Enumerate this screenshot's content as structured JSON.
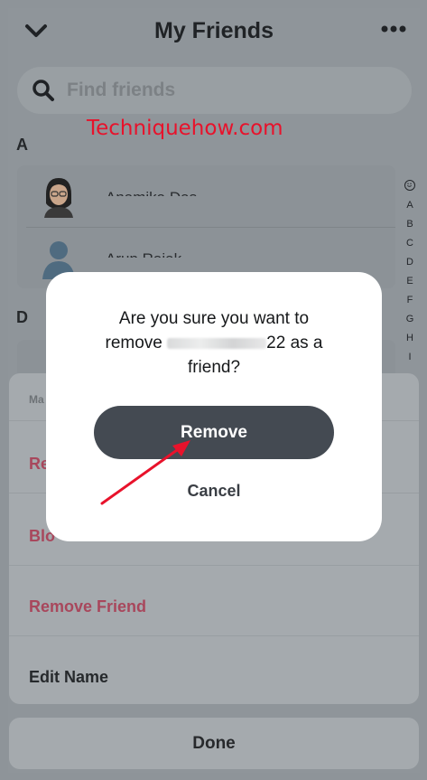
{
  "header": {
    "title": "My Friends"
  },
  "search": {
    "placeholder": "Find friends"
  },
  "watermark": "Techniquehow.com",
  "sections": {
    "a": "A",
    "d": "D"
  },
  "friends": [
    {
      "name": "Anamika Das"
    },
    {
      "name": "Arup Rajak"
    }
  ],
  "alphabet_index": [
    "A",
    "B",
    "C",
    "D",
    "E",
    "F",
    "G",
    "H",
    "I"
  ],
  "sheet": {
    "heading": "Ma",
    "items": [
      {
        "label": "Re",
        "tone": "red"
      },
      {
        "label": "Blo",
        "tone": "red"
      },
      {
        "label": "Remove Friend",
        "tone": "red"
      },
      {
        "label": "Edit Name",
        "tone": "dark"
      }
    ],
    "done_label": "Done"
  },
  "dialog": {
    "line1": "Are you sure you want to",
    "line2_prefix": "remove",
    "line2_suffix": "22 as a",
    "line3": "friend?",
    "remove_label": "Remove",
    "cancel_label": "Cancel"
  },
  "colors": {
    "accent_red": "#e8122b",
    "destructive": "#a8475c",
    "primary_button": "#444a52"
  },
  "icons": [
    "chevron-down-icon",
    "more-dots-icon",
    "search-icon",
    "bitmoji-avatar-icon",
    "default-avatar-icon",
    "smiley-icon",
    "annotation-arrow-icon"
  ]
}
